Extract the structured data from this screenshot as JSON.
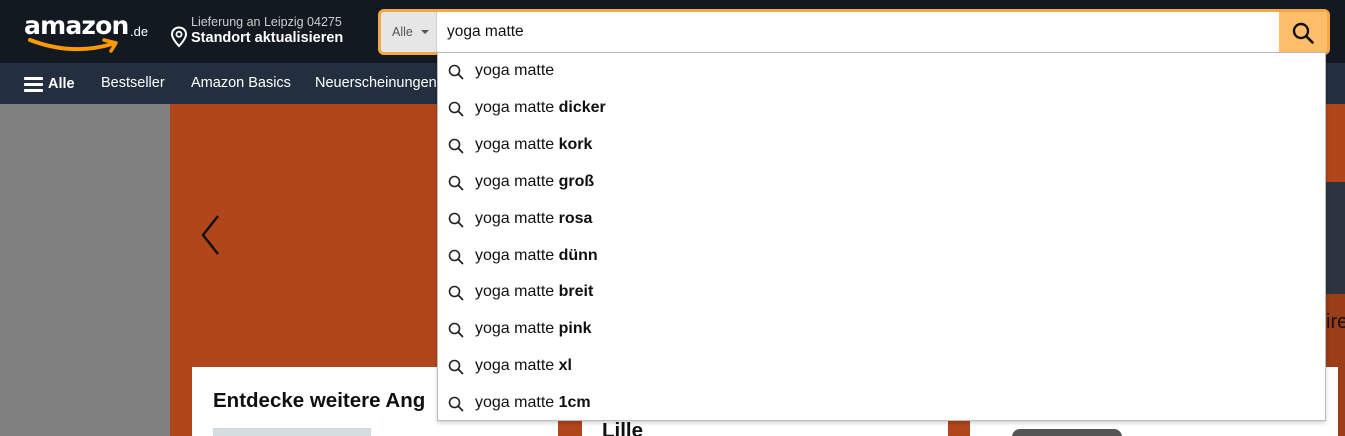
{
  "header": {
    "logo_text": "amazon",
    "logo_tld": ".de",
    "delivery_line1": "Lieferung an Leipzig 04275",
    "delivery_line2": "Standort aktualisieren",
    "search_category": "Alle",
    "search_value": "yoga matte",
    "accent_color": "#febd69",
    "icons": {
      "location": "location-pin-icon",
      "search": "magnifier-icon",
      "menu": "hamburger-icon"
    }
  },
  "nav": {
    "all_label": "Alle",
    "links": [
      "Bestseller",
      "Amazon Basics",
      "Neuerscheinungen"
    ]
  },
  "suggestions": [
    {
      "prefix": "yoga matte",
      "suffix": ""
    },
    {
      "prefix": "yoga matte ",
      "suffix": "dicker"
    },
    {
      "prefix": "yoga matte ",
      "suffix": "kork"
    },
    {
      "prefix": "yoga matte ",
      "suffix": "groß"
    },
    {
      "prefix": "yoga matte ",
      "suffix": "rosa"
    },
    {
      "prefix": "yoga matte ",
      "suffix": "dünn"
    },
    {
      "prefix": "yoga matte ",
      "suffix": "breit"
    },
    {
      "prefix": "yoga matte ",
      "suffix": "pink"
    },
    {
      "prefix": "yoga matte ",
      "suffix": "xl"
    },
    {
      "prefix": "yoga matte ",
      "suffix": "1cm"
    }
  ],
  "main": {
    "card1_title": "Entdecke weitere Ang",
    "card2_title": "Lille",
    "hero_edge_text": "ire",
    "hero_color": "#b2461b"
  }
}
